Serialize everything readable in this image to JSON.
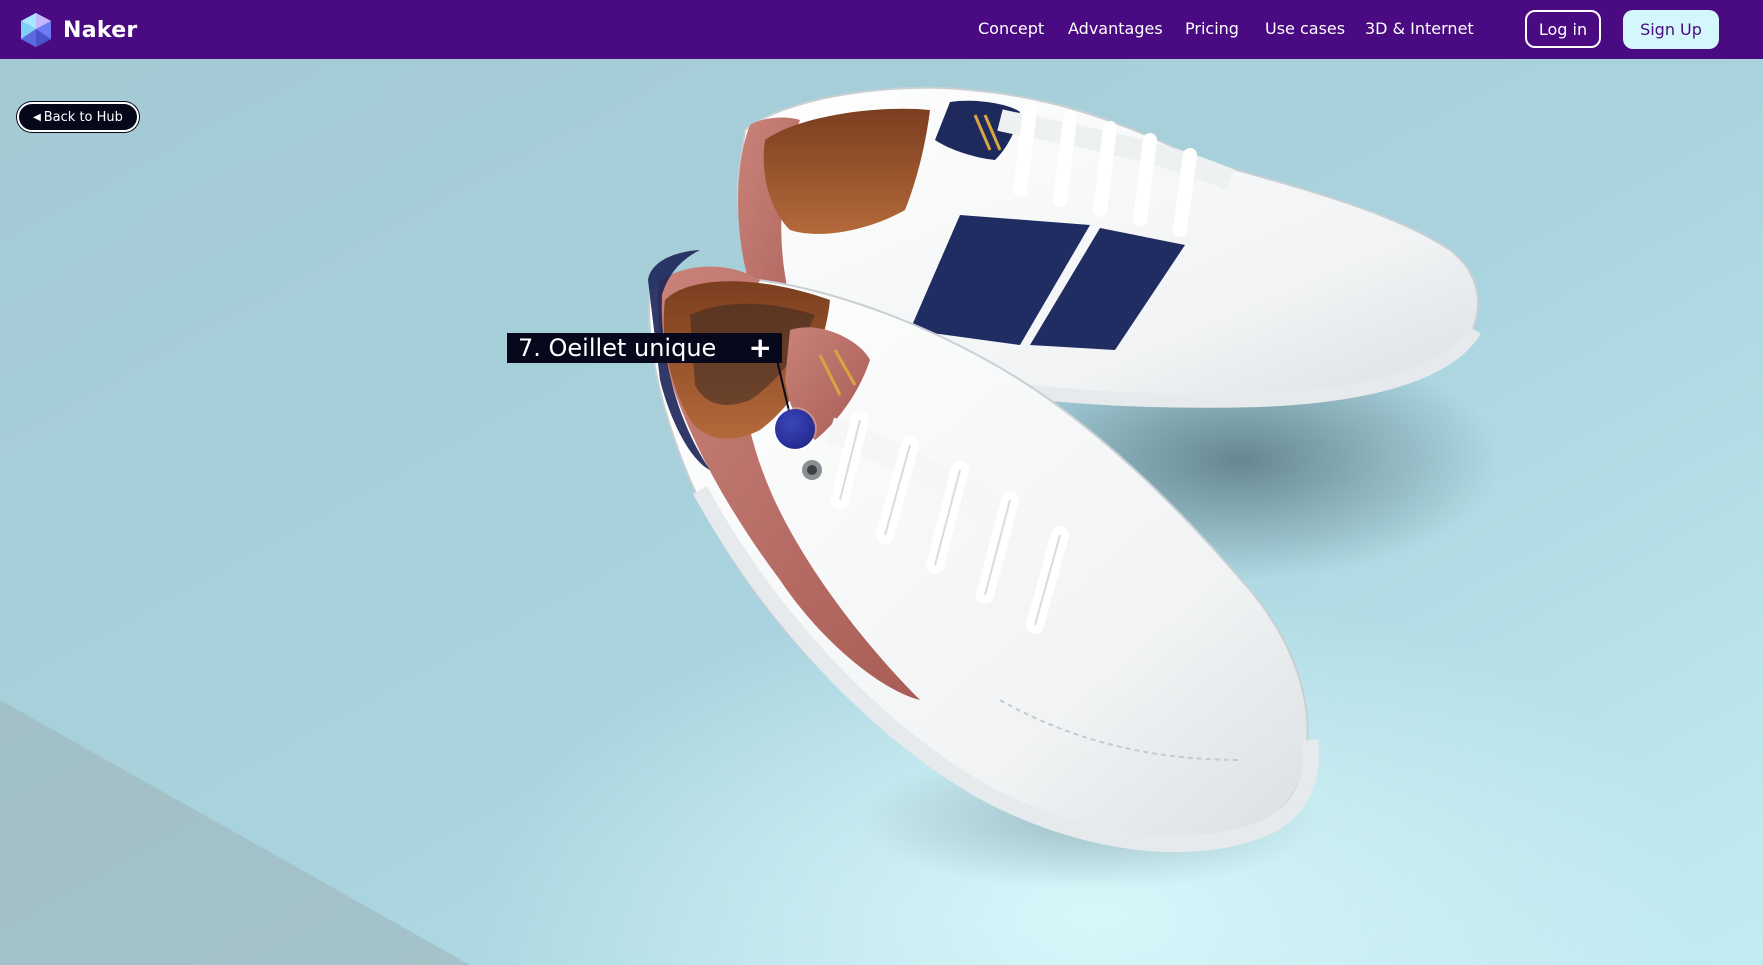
{
  "brand": {
    "name": "Naker",
    "logo_icon": "gem-icon",
    "nav_color": "#4a0a82",
    "accent_color": "#d3f7fb"
  },
  "nav": {
    "links": [
      {
        "label": "Concept"
      },
      {
        "label": "Advantages"
      },
      {
        "label": "Pricing"
      },
      {
        "label": "Use cases"
      },
      {
        "label": "3D & Internet"
      }
    ],
    "login_label": "Log in",
    "signup_label": "Sign Up"
  },
  "back_button": {
    "icon": "left-triangle-icon",
    "label": "Back to Hub"
  },
  "hotspot": {
    "title": "7. Oeillet unique",
    "expand_icon": "plus-icon",
    "marker_color": "#2a2f9a"
  },
  "scene": {
    "subject": "sneaker-pair-3d-model",
    "background_color": "#a8d0da"
  }
}
